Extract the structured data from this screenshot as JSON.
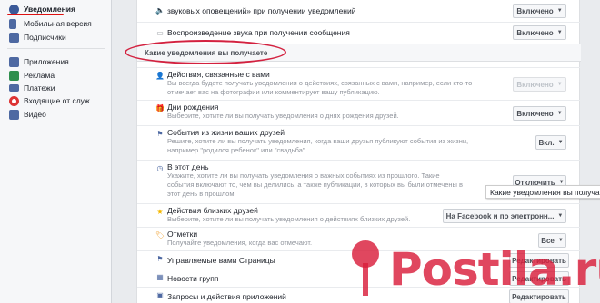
{
  "sidebar": {
    "items": [
      {
        "label": "Уведомления",
        "icon": "globe-icon",
        "color": "#3b5998"
      },
      {
        "label": "Мобильная версия",
        "icon": "mobile-icon",
        "color": "#4e69a2"
      },
      {
        "label": "Подписчики",
        "icon": "rss-icon",
        "color": "#4e69a2"
      },
      {
        "label": "Приложения",
        "icon": "apps-icon",
        "color": "#4e69a2"
      },
      {
        "label": "Реклама",
        "icon": "ads-icon",
        "color": "#2f8f4e"
      },
      {
        "label": "Платежи",
        "icon": "card-icon",
        "color": "#4e69a2"
      },
      {
        "label": "Входящие от служ...",
        "icon": "lifebuoy-icon",
        "color": "#d33"
      },
      {
        "label": "Видео",
        "icon": "video-icon",
        "color": "#4e69a2"
      }
    ]
  },
  "top_rows": [
    {
      "title": "звуковых оповещений» при получении уведомлений",
      "dropdown": "Включено"
    },
    {
      "title": "Воспроизведение звука при получении сообщения",
      "dropdown": "Включено"
    }
  ],
  "section_title": "Какие уведомления вы получаете",
  "rows": [
    {
      "title": "Действия, связанные с вами",
      "desc": "Вы всегда будете получать уведомления о действиях, связанных с вами, например, если кто-то отмечает вас на фотографии или комментирует вашу публикацию.",
      "dropdown": "Включено",
      "disabled": true
    },
    {
      "title": "Дни рождения",
      "desc": "Выберите, хотите ли вы получать уведомления о днях рождения друзей.",
      "dropdown": "Включено"
    },
    {
      "title": "События из жизни ваших друзей",
      "desc": "Решите, хотите ли вы получать уведомления, когда ваши друзья публикуют события из жизни, например \"родился ребенок\" или \"свадьба\".",
      "dropdown": "Вкл."
    },
    {
      "title": "В этот день",
      "desc": "Укажите, хотите ли вы получать уведомления о важных событиях из прошлого. Такие события включают то, чем вы делились, а также публикации, в которых вы были отмечены в этот день в прошлом.",
      "dropdown": "Отключить"
    },
    {
      "title": "Действия близких друзей",
      "desc": "Выберите, хотите ли вы получать уведомления о действиях близких друзей.",
      "dropdown": "На Facebook и по электронн..."
    },
    {
      "title": "Отметки",
      "desc": "Получайте уведомления, когда вас отмечают.",
      "dropdown": "Все"
    },
    {
      "title": "Управляемые вами Страницы",
      "desc": "",
      "dropdown": "Редактировать"
    },
    {
      "title": "Новости групп",
      "desc": "",
      "dropdown": "Редактировать"
    },
    {
      "title": "Запросы и действия приложений",
      "desc": "",
      "dropdown": "Редактировать"
    }
  ],
  "tooltip": "Какие уведомления вы получаете",
  "watermark": "Postila.ru",
  "accent": "#d3213f"
}
